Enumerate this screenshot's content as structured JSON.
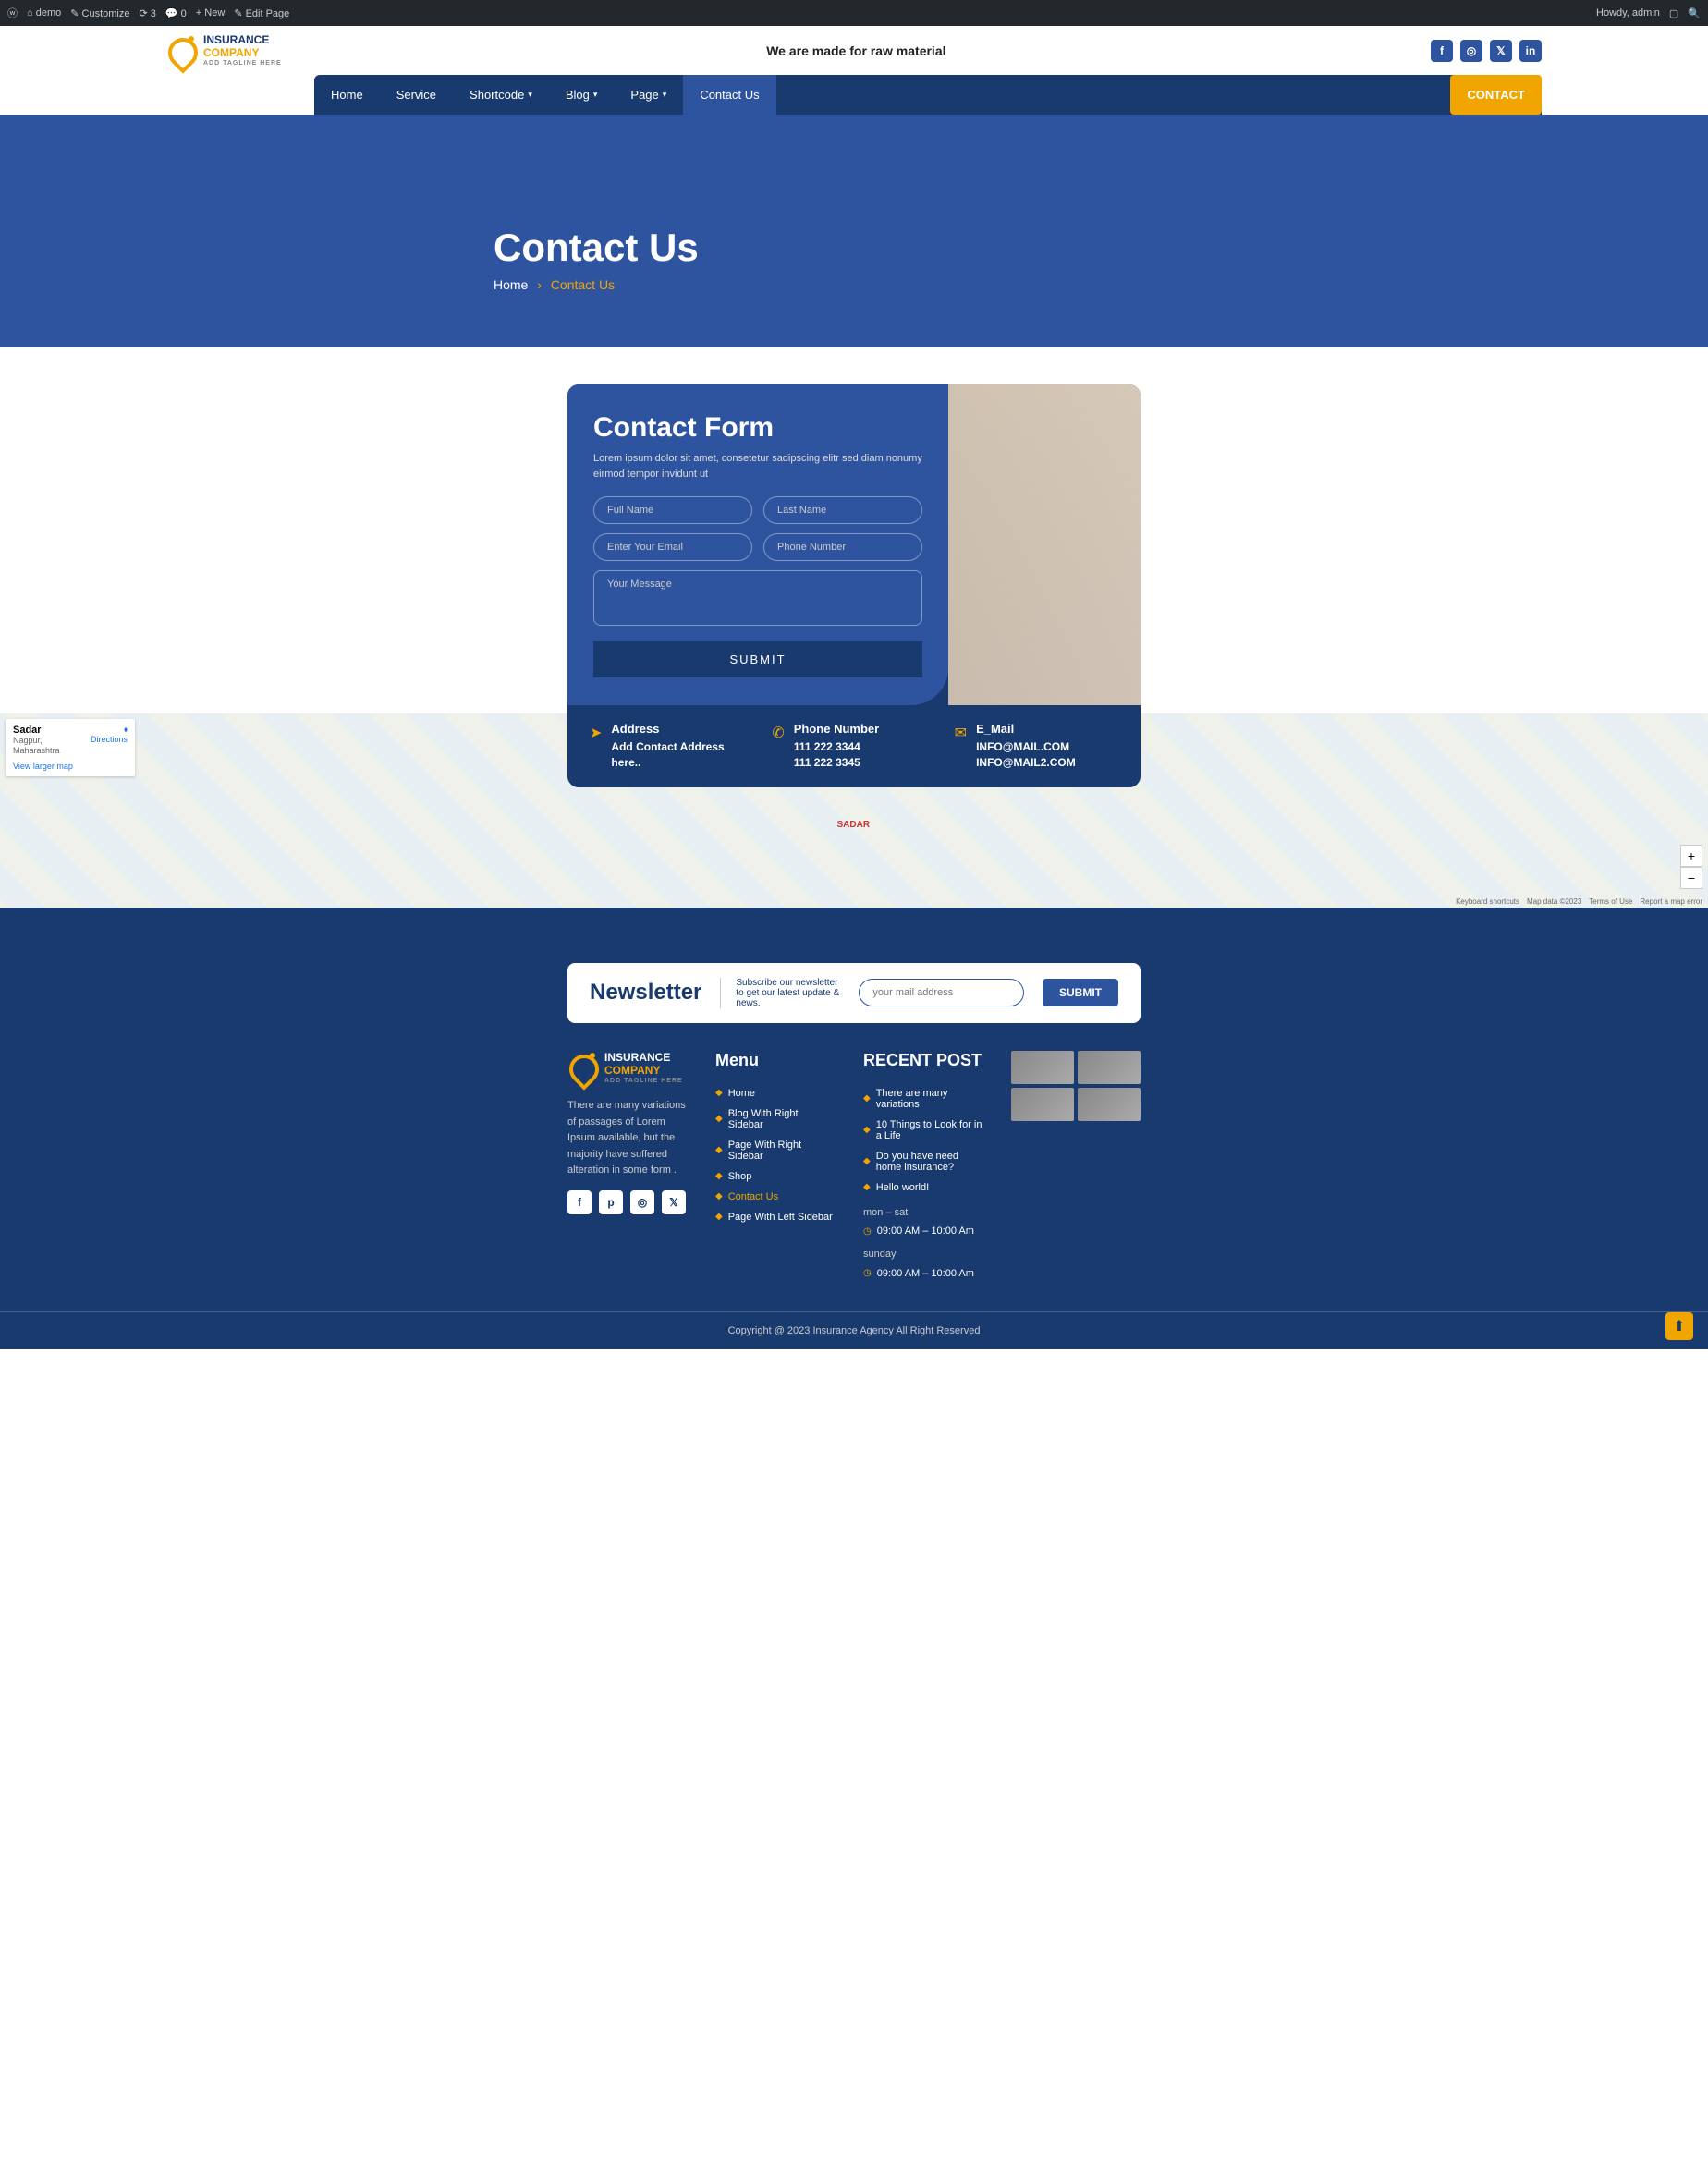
{
  "adminbar": {
    "site": "demo",
    "customize": "Customize",
    "updates": "3",
    "comments": "0",
    "new": "New",
    "edit": "Edit Page",
    "howdy": "Howdy, admin"
  },
  "topbar": {
    "logo1": "INSURANCE",
    "logo2": "COMPANY",
    "logo3": "ADD TAGLINE HERE",
    "tagline": "We are made for raw material"
  },
  "nav": {
    "items": [
      "Home",
      "Service",
      "Shortcode",
      "Blog",
      "Page",
      "Contact Us"
    ],
    "contact": "CONTACT"
  },
  "hero": {
    "title": "Contact Us",
    "home": "Home",
    "current": "Contact Us"
  },
  "form": {
    "title": "Contact Form",
    "desc": "Lorem ipsum dolor sit amet, consetetur sadipscing elitr sed diam nonumy eirmod tempor invidunt ut",
    "ph_fname": "Full Name",
    "ph_lname": "Last Name",
    "ph_email": "Enter Your Email",
    "ph_phone": "Phone Number",
    "ph_msg": "Your Message",
    "submit": "SUBMIT"
  },
  "info": {
    "address": {
      "label": "Address",
      "value": "Add Contact Address here.."
    },
    "phone": {
      "label": "Phone Number",
      "v1": "111 222 3344",
      "v2": "111 222 3345"
    },
    "email": {
      "label": "E_Mail",
      "v1": "INFO@MAIL.COM",
      "v2": "INFO@MAIL2.COM"
    }
  },
  "map": {
    "title": "Sadar",
    "sub": "Nagpur, Maharashtra",
    "dir": "Directions",
    "view": "View larger map",
    "zoom_in": "+",
    "zoom_out": "−",
    "shortcuts": "Keyboard shortcuts",
    "mapdata": "Map data ©2023",
    "terms": "Terms of Use",
    "report": "Report a map error",
    "center_label": "SADAR"
  },
  "newsletter": {
    "title": "Newsletter",
    "text": "Subscribe our newsletter to get our latest update & news.",
    "ph": "your mail address",
    "btn": "SUBMIT"
  },
  "footer": {
    "about": "There are many variations of passages of Lorem Ipsum available, but the majority have suffered alteration in some form .",
    "menu_title": "Menu",
    "menu": [
      "Home",
      "Blog With Right Sidebar",
      "Page With Right Sidebar",
      "Shop",
      "Contact Us",
      "Page With Left Sidebar"
    ],
    "recent_title": "RECENT POST",
    "recent": [
      "There are many variations",
      "10 Things to Look for in a Life",
      "Do you have need home insurance?",
      "Hello world!"
    ],
    "hours1": "mon – sat",
    "time1": "09:00 AM – 10:00 Am",
    "hours2": "sunday",
    "time2": "09:00 AM – 10:00 Am",
    "copyright": "Copyright @ 2023 Insurance Agency All Right Reserved"
  }
}
